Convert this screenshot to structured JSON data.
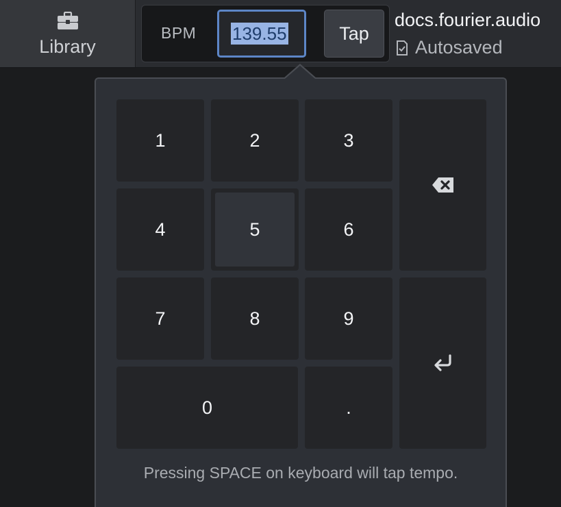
{
  "header": {
    "library_label": "Library",
    "library_icon": "briefcase-icon",
    "bpm_label": "BPM",
    "bpm_value": "139.55",
    "tap_label": "Tap",
    "document_title": "docs.fourier.audio",
    "status_icon": "document-check-icon",
    "status_text": "Autosaved"
  },
  "keypad": {
    "keys": {
      "k1": "1",
      "k2": "2",
      "k3": "3",
      "k4": "4",
      "k5": "5",
      "k6": "6",
      "k7": "7",
      "k8": "8",
      "k9": "9",
      "k0": "0",
      "dot": "."
    },
    "backspace_icon": "backspace-icon",
    "enter_icon": "enter-icon",
    "hint": "Pressing SPACE on keyboard will tap tempo."
  },
  "colors": {
    "accent": "#5d86c7",
    "selection": "#98b4e4",
    "popover_bg": "#2d3036",
    "key_bg": "#242528"
  }
}
